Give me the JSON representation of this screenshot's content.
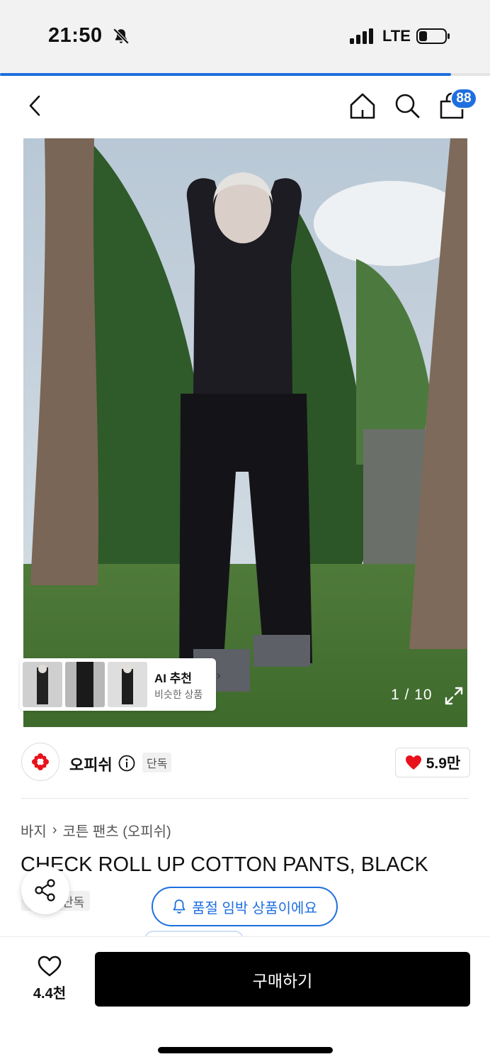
{
  "status_bar": {
    "time": "21:50",
    "network": "LTE",
    "icons": [
      "bell-muted-icon",
      "signal-icon",
      "battery-icon"
    ]
  },
  "page_progress": 0.92,
  "nav": {
    "back_icon": "chevron-left-icon",
    "home_icon": "home-icon",
    "search_icon": "search-icon",
    "cart_icon": "shopping-bag-icon",
    "cart_count": "88"
  },
  "gallery": {
    "current": "1",
    "total": "10",
    "indicator": "1 / 10",
    "ai_recommend": {
      "title": "AI 추천",
      "subtitle": "비슷한 상품",
      "chevron": "›"
    }
  },
  "brand": {
    "name": "오피쉬",
    "tag": "단독",
    "likes": "5.9만"
  },
  "product": {
    "breadcrumb": [
      "바지",
      "코튼 팬츠 (오피쉬)"
    ],
    "breadcrumb_separator": "›",
    "title": "CHECK ROLL UP COTTON PANTS, BLACK",
    "tag": "단독"
  },
  "toast": {
    "text": "품절 임박 상품이에요"
  },
  "bottom_bar": {
    "wish_count": "4.4천",
    "buy_label": "구매하기"
  },
  "colors": {
    "accent": "#1e6fe0",
    "heart": "#e8121c",
    "buy_button": "#000000"
  }
}
